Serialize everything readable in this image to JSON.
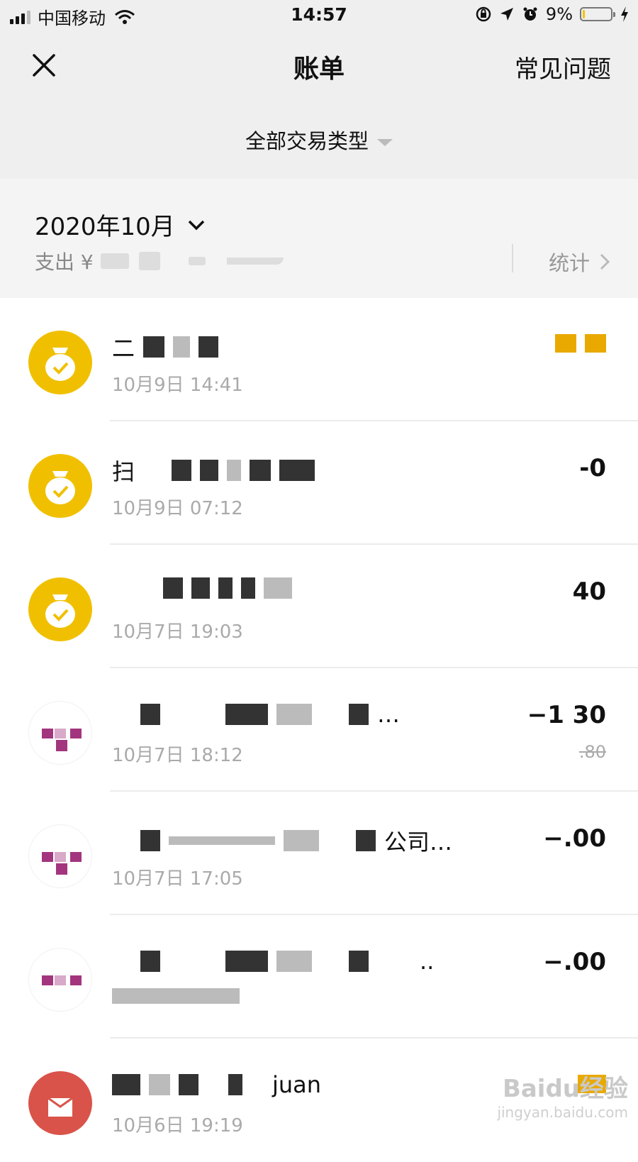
{
  "status_bar": {
    "carrier": "中国移动",
    "time": "14:57",
    "battery_percent": "9%",
    "battery_level": 0.09,
    "icons": [
      "signal-icon",
      "wifi-icon",
      "rotation-lock-icon",
      "location-icon",
      "alarm-icon",
      "battery-icon",
      "charging-icon"
    ]
  },
  "nav": {
    "title": "账单",
    "faq_label": "常见问题",
    "close_icon": "close-icon"
  },
  "filter": {
    "label": "全部交易类型",
    "icon": "caret-down-icon"
  },
  "month": {
    "label": "2020年10月",
    "expense_label": "支出 ¥",
    "stats_label": "统计"
  },
  "transactions": [
    {
      "title": "二",
      "time": "10月9日 14:41",
      "amount": "",
      "amount_color": "#e9a900",
      "icon": "money-bag-icon"
    },
    {
      "title": "扫",
      "time": "10月9日 07:12",
      "amount": "-0",
      "icon": "money-bag-icon"
    },
    {
      "title": "",
      "time": "10月7日 19:03",
      "amount": "40",
      "icon": "money-bag-icon"
    },
    {
      "title": "…",
      "time": "10月7日 18:12",
      "amount": "−1 30",
      "sub": ".80",
      "icon": "store-icon"
    },
    {
      "title": "公司…",
      "time": "10月7日 17:05",
      "amount": "−.00",
      "icon": "store-icon"
    },
    {
      "title": "..",
      "time": "",
      "amount": "−.00",
      "icon": "store-icon"
    },
    {
      "title": "juan",
      "time": "10月6日 19:19",
      "amount": "",
      "amount_color": "#e9a900",
      "icon": "red-packet-icon"
    }
  ],
  "watermark": {
    "logo": "Baidu经验",
    "url": "jingyan.baidu.com"
  },
  "colors": {
    "accent_yellow": "#f0c000",
    "header_bg": "#efefef",
    "muted_text": "#aaaaaa"
  }
}
